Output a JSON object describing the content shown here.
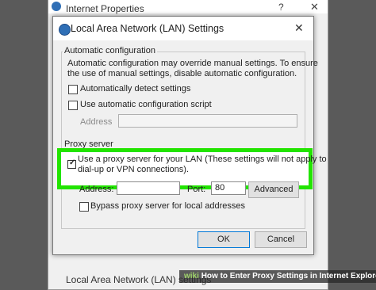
{
  "background_window": {
    "title": "Internet Properties",
    "help_label": "?",
    "close_label": "✕",
    "bottom_text": "Local Area Network (LAN) settings"
  },
  "dialog": {
    "title": "Local Area Network (LAN) Settings",
    "close_label": "✕",
    "auto_config": {
      "heading": "Automatic configuration",
      "description_line1": "Automatic configuration may override manual settings.  To ensure",
      "description_line2": "the use of manual settings, disable automatic configuration.",
      "auto_detect_label": "Automatically detect settings",
      "auto_detect_checked": false,
      "use_script_label": "Use automatic configuration script",
      "use_script_checked": false,
      "address_label": "Address",
      "address_value": ""
    },
    "proxy": {
      "heading": "Proxy server",
      "use_proxy_line1": "Use a proxy server for your LAN (These settings will not apply to",
      "use_proxy_line2": "dial-up or VPN connections).",
      "use_proxy_checked": true,
      "address_label": "Address:",
      "address_value": "",
      "port_label": "Port:",
      "port_value": "80",
      "advanced_label": "Advanced",
      "bypass_label": "Bypass proxy server for local addresses",
      "bypass_checked": false
    },
    "ok_label": "OK",
    "cancel_label": "Cancel"
  },
  "watermark": {
    "prefix": "wiki",
    "text": "How to Enter Proxy Settings in Internet Explorer"
  },
  "colors": {
    "highlight": "#22e400",
    "ok_border": "#0078d7"
  }
}
